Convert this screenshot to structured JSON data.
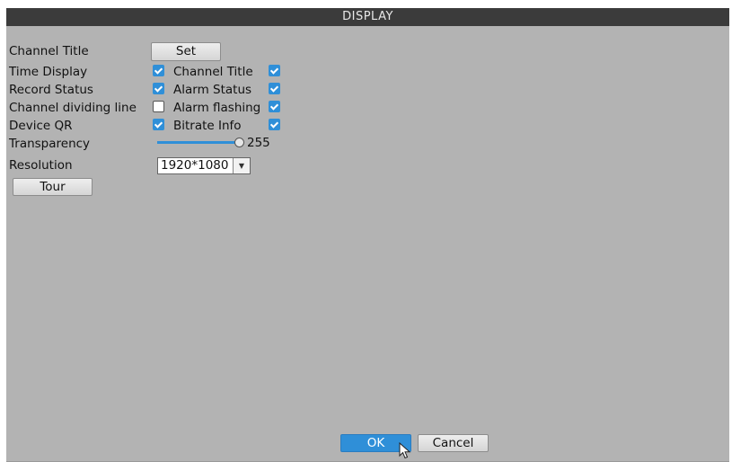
{
  "dialog": {
    "title": "DISPLAY"
  },
  "rows": {
    "channel_title": {
      "label": "Channel Title",
      "button": "Set"
    },
    "time_display": {
      "label": "Time Display",
      "checked": true
    },
    "channel_title_toggle": {
      "label": "Channel Title",
      "checked": true
    },
    "record_status": {
      "label": "Record Status",
      "checked": true
    },
    "alarm_status": {
      "label": "Alarm Status",
      "checked": true
    },
    "channel_dividing_line": {
      "label": "Channel dividing line",
      "checked": false
    },
    "alarm_flashing": {
      "label": "Alarm flashing",
      "checked": true
    },
    "device_qr": {
      "label": "Device QR",
      "checked": true
    },
    "bitrate_info": {
      "label": "Bitrate Info",
      "checked": true
    },
    "transparency": {
      "label": "Transparency",
      "value": "255"
    },
    "resolution": {
      "label": "Resolution",
      "value": "1920*1080"
    },
    "tour": {
      "button": "Tour"
    }
  },
  "footer": {
    "ok": "OK",
    "cancel": "Cancel"
  },
  "colors": {
    "accent": "#2f8fd8",
    "panel": "#b3b3b3",
    "titlebar": "#3b3b3b"
  },
  "icons": {
    "checkbox_checked": "check-icon",
    "cursor": "mouse-pointer-icon",
    "dropdown": "chevron-down-icon"
  }
}
